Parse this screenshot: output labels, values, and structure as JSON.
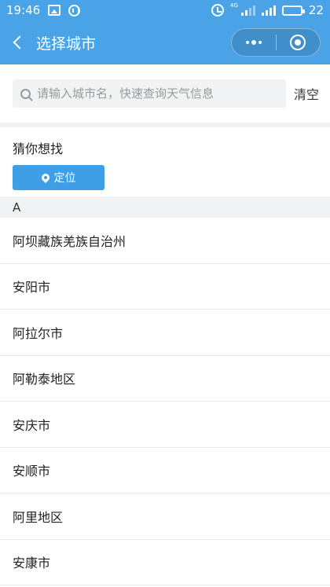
{
  "status_bar": {
    "time": "19:46",
    "network_type": "4G",
    "battery": "22",
    "battery_level": 0.22
  },
  "nav": {
    "title": "选择城市",
    "back_icon": "chevron-left-icon",
    "more_icon": "more-dots-icon",
    "close_icon": "target-circle-icon"
  },
  "search": {
    "placeholder": "请输入城市名，快速查询天气信息",
    "value": "",
    "clear_label": "清空"
  },
  "guess": {
    "title": "猜你想找",
    "locate_label": "定位"
  },
  "section": {
    "letter": "A"
  },
  "cities": [
    {
      "name": "阿坝藏族羌族自治州"
    },
    {
      "name": "安阳市"
    },
    {
      "name": "阿拉尔市"
    },
    {
      "name": "阿勒泰地区"
    },
    {
      "name": "安庆市"
    },
    {
      "name": "安顺市"
    },
    {
      "name": "阿里地区"
    },
    {
      "name": "安康市"
    }
  ],
  "colors": {
    "header_blue": "#4aa3e6",
    "button_blue": "#3e9fe6",
    "section_gray": "#f1f2f4"
  }
}
